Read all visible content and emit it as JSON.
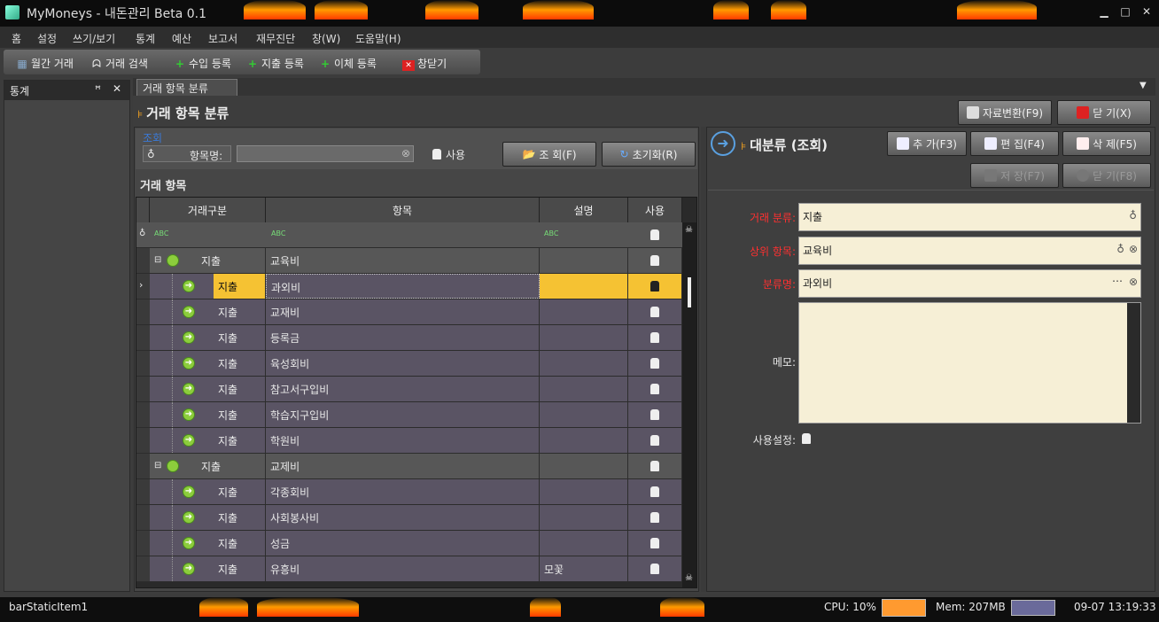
{
  "app": {
    "title": "MyMoneys - 내돈관리 Beta 0.1"
  },
  "menu": [
    "홈",
    "설정",
    "쓰기/보기",
    "통계",
    "예산",
    "보고서",
    "재무진단",
    "창(W)",
    "도움말(H)"
  ],
  "toolbar": {
    "monthly": "월간 거래",
    "search": "거래 검색",
    "income": "수입 등록",
    "expense": "지출 등록",
    "transfer": "이체 등록",
    "close_window": "창닫기"
  },
  "left_panel": {
    "title": "통계"
  },
  "doc_tab": {
    "label": "거래 항목 분류"
  },
  "page": {
    "title": "거래 항목 분류"
  },
  "top_buttons": {
    "convert": "자료변환(F9)",
    "close": "닫 기(X)"
  },
  "search": {
    "group_label": "조회",
    "item_label": "항목명:",
    "item_value": "",
    "use_label": "사용",
    "search_btn": "조 회(F)",
    "reset_btn": "초기화(R)"
  },
  "grid": {
    "section_title": "거래 항목",
    "columns": [
      "거래구분",
      "항목",
      "설명",
      "사용"
    ],
    "rows": [
      {
        "level": 0,
        "type": "지출",
        "item": "교육비",
        "desc": "",
        "selected": false
      },
      {
        "level": 1,
        "type": "지출",
        "item": "과외비",
        "desc": "",
        "selected": true
      },
      {
        "level": 1,
        "type": "지출",
        "item": "교재비",
        "desc": "",
        "selected": false
      },
      {
        "level": 1,
        "type": "지출",
        "item": "등록금",
        "desc": "",
        "selected": false
      },
      {
        "level": 1,
        "type": "지출",
        "item": "육성회비",
        "desc": "",
        "selected": false
      },
      {
        "level": 1,
        "type": "지출",
        "item": "참고서구입비",
        "desc": "",
        "selected": false
      },
      {
        "level": 1,
        "type": "지출",
        "item": "학습지구입비",
        "desc": "",
        "selected": false
      },
      {
        "level": 1,
        "type": "지출",
        "item": "학원비",
        "desc": "",
        "selected": false
      },
      {
        "level": 0,
        "type": "지출",
        "item": "교제비",
        "desc": "",
        "selected": false
      },
      {
        "level": 1,
        "type": "지출",
        "item": "각종회비",
        "desc": "",
        "selected": false
      },
      {
        "level": 1,
        "type": "지출",
        "item": "사회봉사비",
        "desc": "",
        "selected": false
      },
      {
        "level": 1,
        "type": "지출",
        "item": "성금",
        "desc": "",
        "selected": false
      },
      {
        "level": 1,
        "type": "지출",
        "item": "유흥비",
        "desc": "모꽃",
        "selected": false
      }
    ]
  },
  "detail": {
    "title": "대분류 (조회)",
    "add": "추 가(F3)",
    "edit": "편 집(F4)",
    "delete": "삭 제(F5)",
    "save": "저 장(F7)",
    "close": "닫 기(F8)",
    "label_type": "거래 분류:",
    "value_type": "지출",
    "label_parent": "상위 항목:",
    "value_parent": "교육비",
    "label_name": "분류명:",
    "value_name": "과외비",
    "label_memo": "메모:",
    "value_memo": "",
    "label_use": "사용설정:"
  },
  "status": {
    "item": "barStaticItem1",
    "cpu": "CPU: 10%",
    "mem": "Mem: 207MB",
    "time": "09-07 13:19:33"
  },
  "colors": {
    "selected_row": "#f5c233",
    "required_label": "#ff3030",
    "field_bg": "#f6efd6"
  }
}
